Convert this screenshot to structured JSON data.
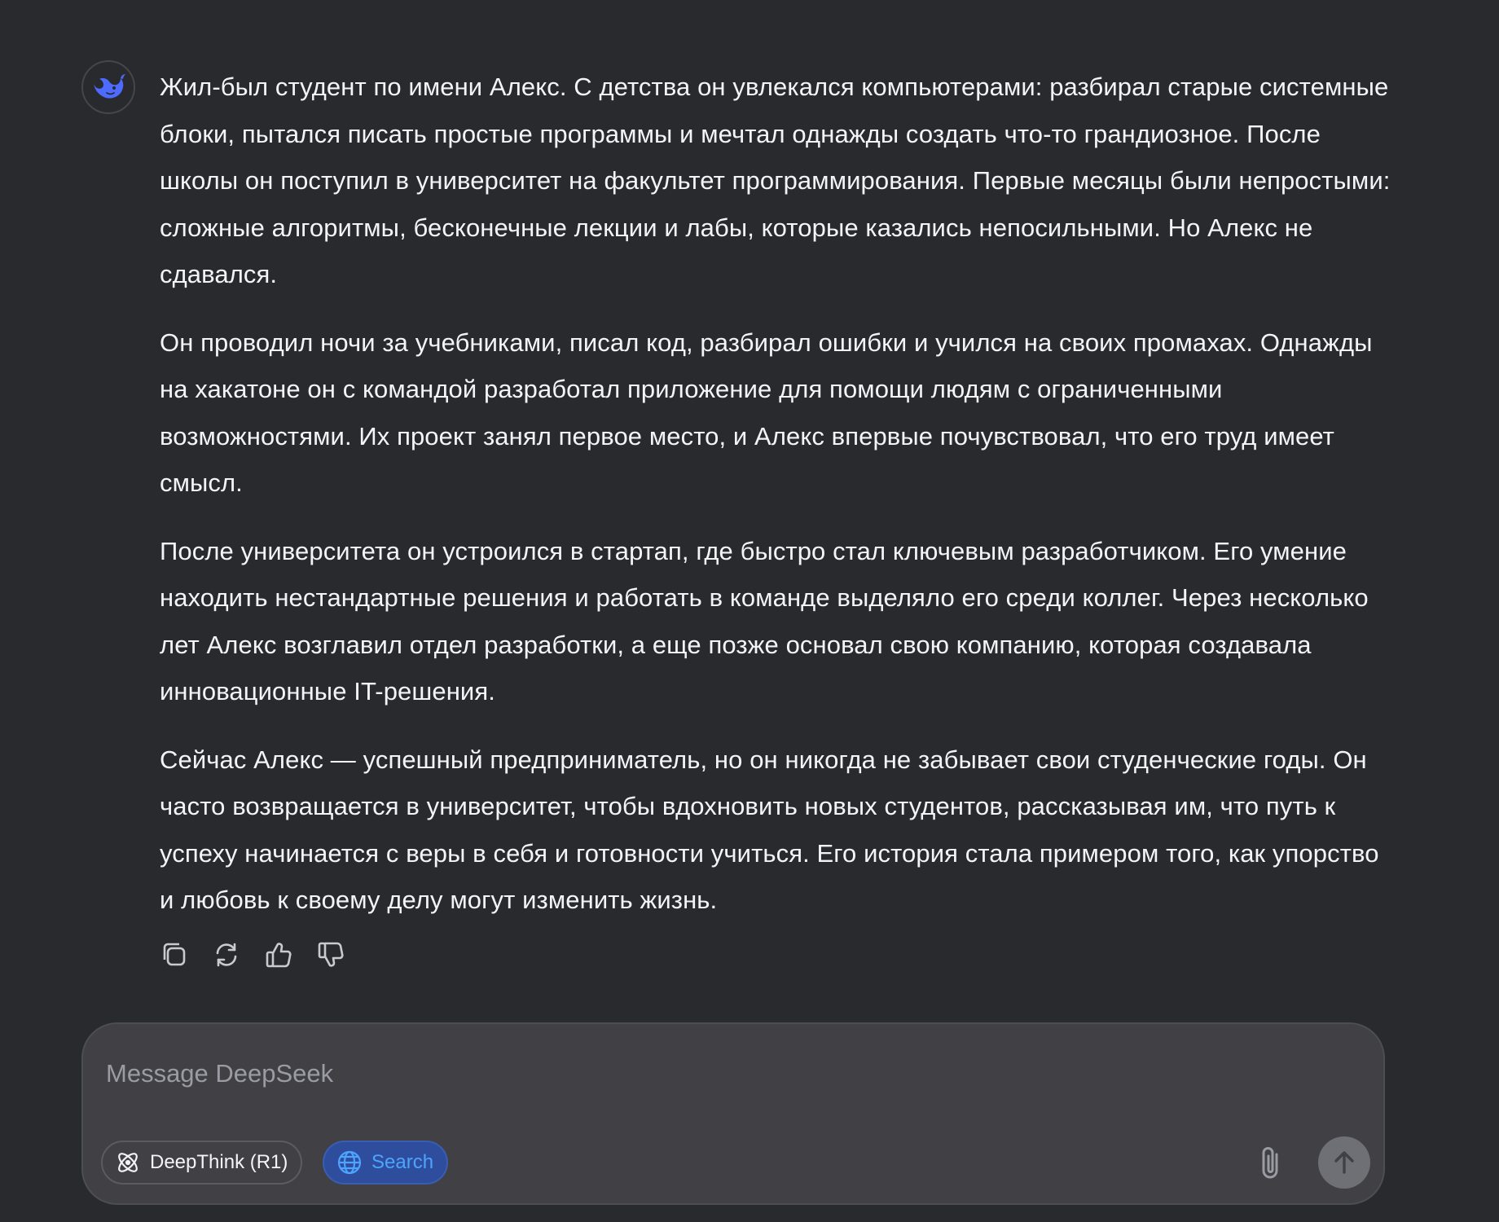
{
  "assistant": {
    "avatar_icon": "deepseek-whale-icon",
    "brand_color": "#4d6bfe"
  },
  "message": {
    "paragraphs": [
      "Жил-был студент по имени Алекс. С детства он увлекался компьютерами: разбирал старые системные блоки, пытался писать простые программы и мечтал однажды создать что-то грандиозное. После школы он поступил в университет на факультет программирования. Первые месяцы были непростыми: сложные алгоритмы, бесконечные лекции и лабы, которые казались непосильными. Но Алекс не сдавался.",
      "Он проводил ночи за учебниками, писал код, разбирал ошибки и учился на своих промахах. Однажды на хакатоне он с командой разработал приложение для помощи людям с ограниченными возможностями. Их проект занял первое место, и Алекс впервые почувствовал, что его труд имеет смысл.",
      "После университета он устроился в стартап, где быстро стал ключевым разработчиком. Его умение находить нестандартные решения и работать в команде выделяло его среди коллег. Через несколько лет Алекс возглавил отдел разработки, а еще позже основал свою компанию, которая создавала инновационные IT-решения.",
      "Сейчас Алекс — успешный предприниматель, но он никогда не забывает свои студенческие годы. Он часто возвращается в университет, чтобы вдохновить новых студентов, рассказывая им, что путь к успеху начинается с веры в себя и готовности учиться. Его история стала примером того, как упорство и любовь к своему делу могут изменить жизнь."
    ]
  },
  "actions": {
    "icons": [
      "copy-icon",
      "regenerate-icon",
      "thumbs-up-icon",
      "thumbs-down-icon"
    ]
  },
  "composer": {
    "placeholder": "Message DeepSeek",
    "value": "",
    "deepthink_label": "DeepThink (R1)",
    "search_label": "Search",
    "search_active": true,
    "search_color": "#4ea3ff",
    "attach_icon": "paperclip-icon",
    "send_icon": "arrow-up-icon"
  }
}
